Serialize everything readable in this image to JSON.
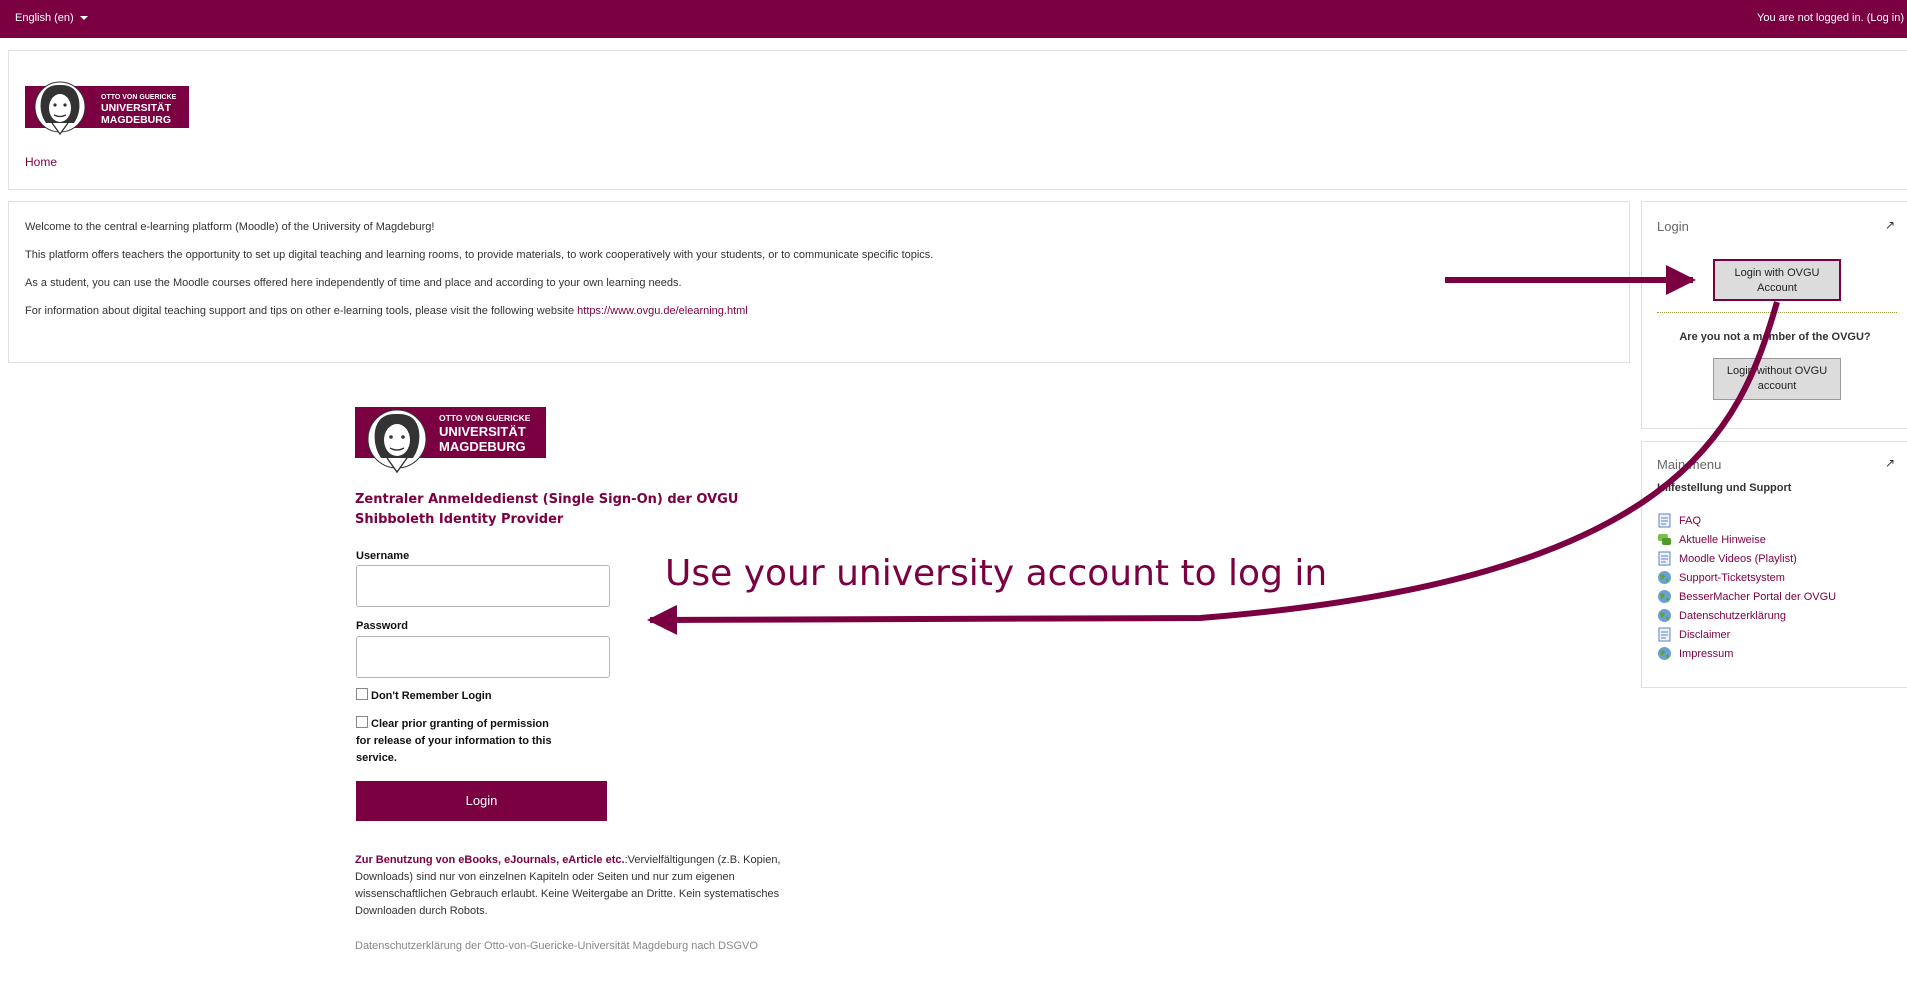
{
  "topbar": {
    "language": "English (en)",
    "auth_status": "You are not logged in. (Log in)"
  },
  "breadcrumb": {
    "home": "Home"
  },
  "logo": {
    "line1": "OTTO VON GUERICKE",
    "line2": "UNIVERSITÄT",
    "line3": "MAGDEBURG"
  },
  "welcome": {
    "line1": "Welcome to the central e-learning platform (Moodle) of the University of Magdeburg!",
    "line2": "This platform offers teachers the opportunity to set up digital teaching and learning rooms, to provide materials, to work cooperatively with your students, or to communicate specific topics.",
    "line3": "As a student, you can use the Moodle courses offered here independently of time and place and according to your own learning needs.",
    "line4_text": "For information about digital teaching support and tips on other e-learning tools, please visit the following website ",
    "line4_link": "https://www.ovgu.de/elearning.html"
  },
  "login_block": {
    "title": "Login",
    "ovgu_button": "Login with OVGU Account",
    "not_member": "Are you not a member of the OVGU?",
    "non_ovgu_button": "Login without OVGU account"
  },
  "main_menu": {
    "title": "Main menu",
    "heading": "Hilfestellung und Support",
    "items": [
      {
        "label": "FAQ",
        "icon": "page-icon"
      },
      {
        "label": "Aktuelle Hinweise",
        "icon": "forum-icon"
      },
      {
        "label": "Moodle Videos (Playlist)",
        "icon": "page-icon"
      },
      {
        "label": "Support-Ticketsystem",
        "icon": "url-icon"
      },
      {
        "label": "BesserMacher Portal der OVGU",
        "icon": "url-icon"
      },
      {
        "label": "Datenschutzerklärung",
        "icon": "url-icon"
      },
      {
        "label": "Disclaimer",
        "icon": "page-icon"
      },
      {
        "label": "Impressum",
        "icon": "url-icon"
      }
    ]
  },
  "sso": {
    "title_line1": "Zentraler Anmeldedienst (Single Sign-On) der OVGU",
    "title_line2": "Shibboleth Identity Provider",
    "username_label": "Username",
    "username_value": "",
    "password_label": "Password",
    "password_value": "",
    "dont_remember": "Don't Remember Login",
    "clear_line1": "Clear prior granting of permission",
    "clear_line2": "for release of your information to this",
    "clear_line3": "service.",
    "login_button": "Login",
    "usage_bold": "Zur Benutzung von eBooks, eJournals, eArticle etc.",
    "usage_line1": ":Vervielfältigungen (z.B. Kopien,",
    "usage_line2": "Downloads) sind nur von einzelnen Kapiteln oder Seiten und nur zum eigenen",
    "usage_line3": "wissenschaftlichen Gebrauch erlaubt. Keine Weitergabe an Dritte. Kein systematisches",
    "usage_line4": "Downloaden durch Robots.",
    "privacy": "Datenschutzerklärung der Otto-von-Guericke-Universität Magdeburg nach DSGVO"
  },
  "callout": {
    "text": "Use your university account to log in"
  },
  "colors": {
    "brand": "#7b0041",
    "button_grey": "#dcdcdc",
    "border": "#e0e0e0"
  }
}
